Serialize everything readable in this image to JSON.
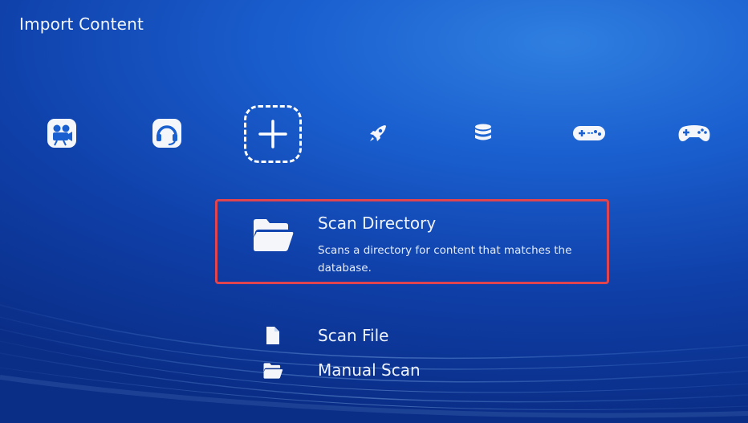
{
  "header": {
    "title": "Import Content"
  },
  "tabs": [
    {
      "icon": "video-camera-icon"
    },
    {
      "icon": "headset-icon"
    },
    {
      "icon": "add-icon",
      "selected": true
    },
    {
      "icon": "rocket-icon"
    },
    {
      "icon": "database-icon"
    },
    {
      "icon": "gamepad-icon"
    },
    {
      "icon": "sega-gamepad-icon"
    }
  ],
  "menu": {
    "items": [
      {
        "label": "Scan Directory",
        "sublabel": "Scans a directory for content that matches the database.",
        "icon": "folder-open-icon",
        "selected": true
      },
      {
        "label": "Scan File",
        "icon": "file-icon"
      },
      {
        "label": "Manual Scan",
        "icon": "folder-open-icon"
      }
    ]
  },
  "colors": {
    "selection_border": "#e0454f",
    "background": "#1a5fcf"
  }
}
